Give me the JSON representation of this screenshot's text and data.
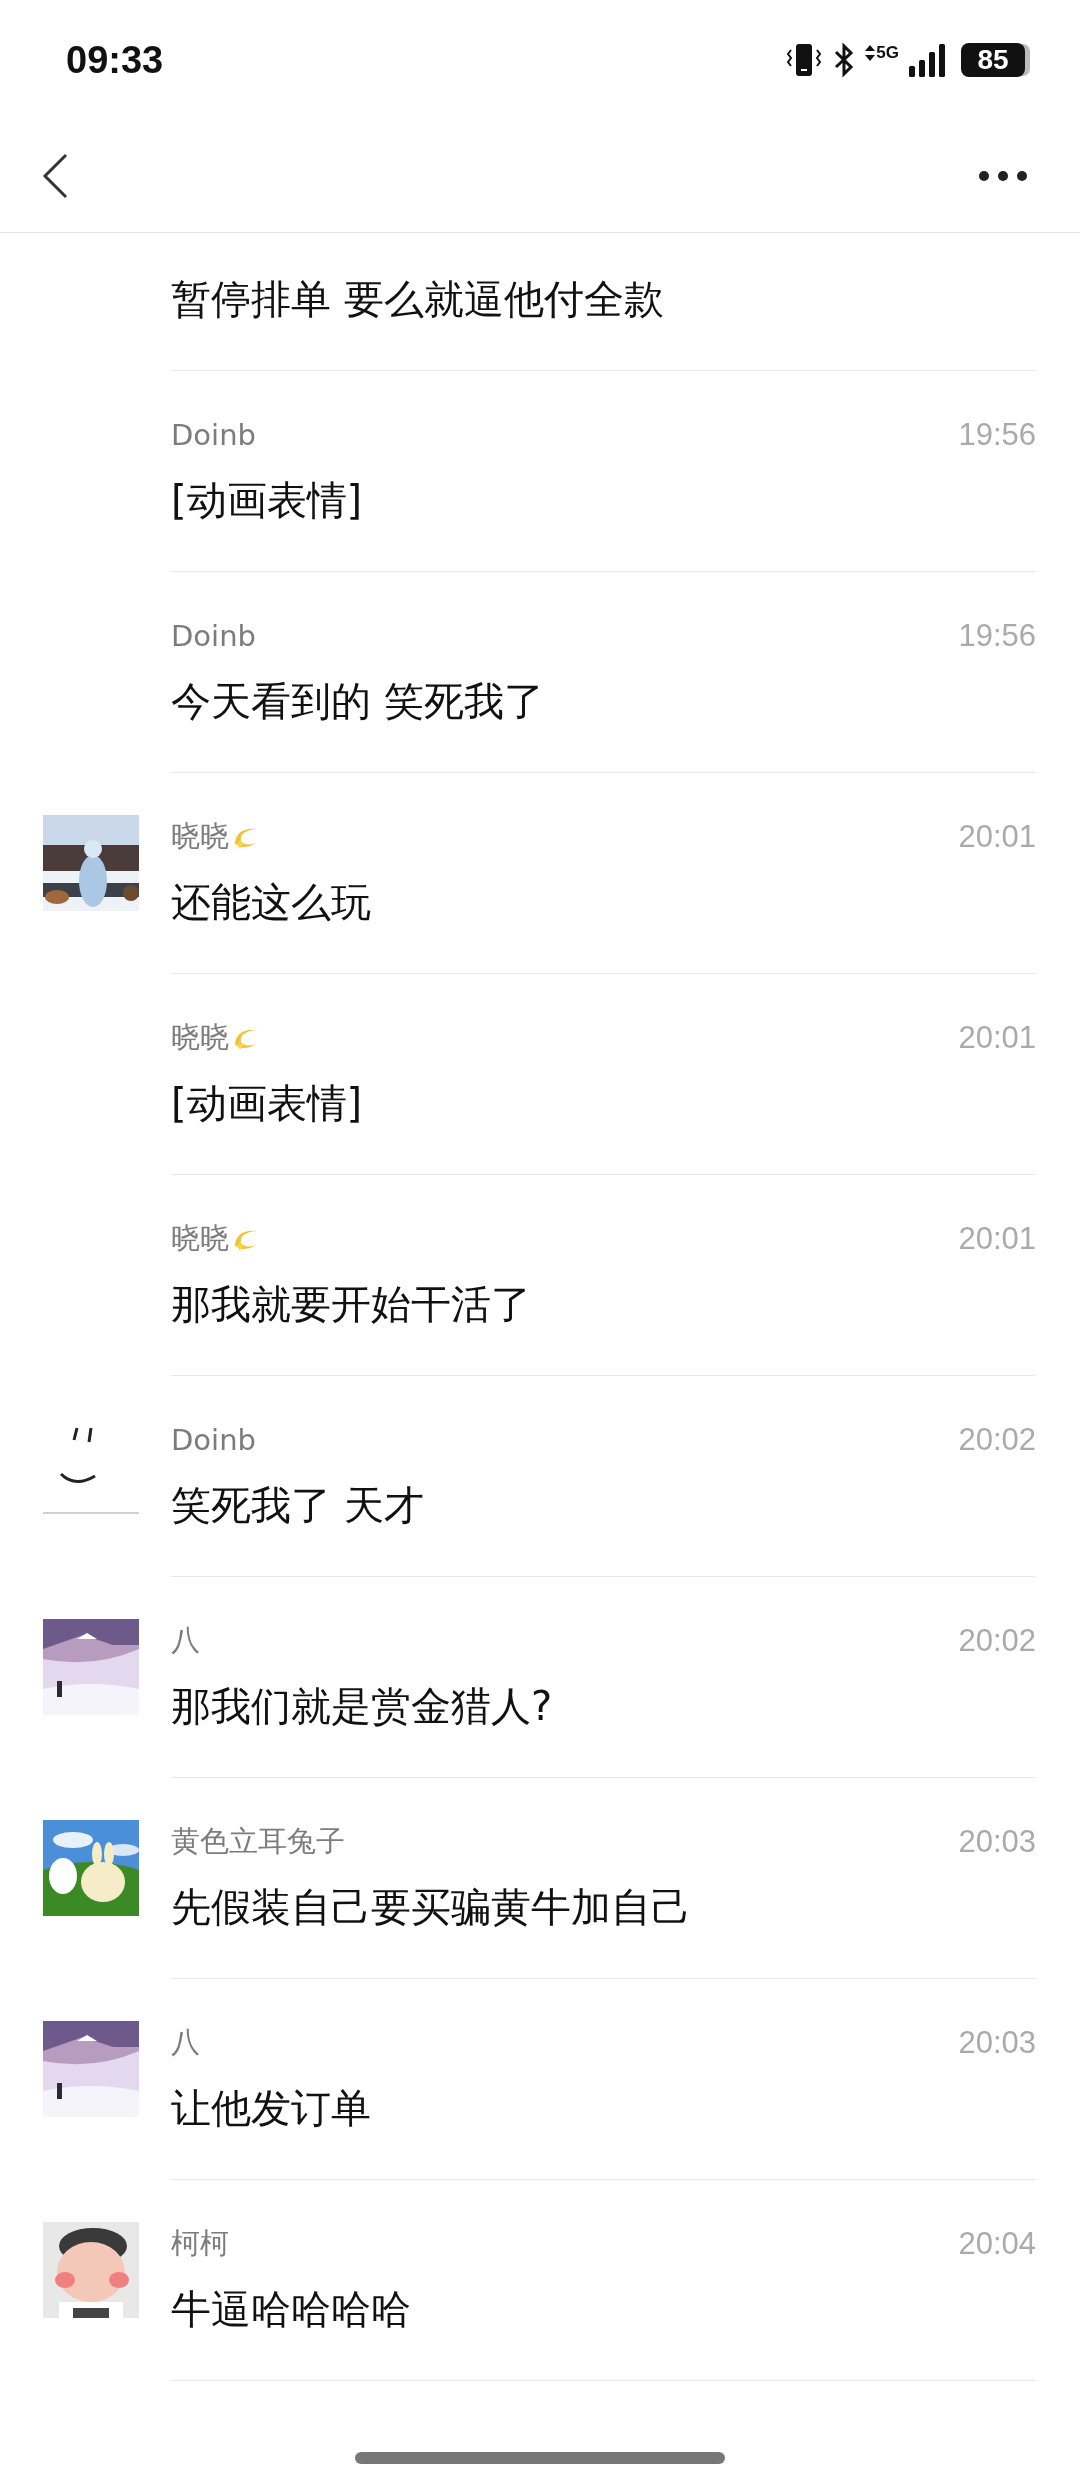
{
  "status_bar": {
    "time": "09:33",
    "network": "5G",
    "battery": "85"
  },
  "messages": [
    {
      "text": "暂停排单 要么就逼他付全款",
      "avatar": false
    },
    {
      "name": "Doinb",
      "badge": false,
      "time": "19:56",
      "text": "[动画表情]",
      "avatar": false
    },
    {
      "name": "Doinb",
      "badge": false,
      "time": "19:56",
      "text": "今天看到的 笑死我了",
      "avatar": false
    },
    {
      "name": "晓晓",
      "badge": true,
      "time": "20:01",
      "text": "还能这么玩",
      "avatar": true
    },
    {
      "name": "晓晓",
      "badge": true,
      "time": "20:01",
      "text": "[动画表情]",
      "avatar": false
    },
    {
      "name": "晓晓",
      "badge": true,
      "time": "20:01",
      "text": "那我就要开始干活了",
      "avatar": false
    },
    {
      "name": "Doinb",
      "badge": false,
      "time": "20:02",
      "text": "笑死我了 天才",
      "avatar": true
    },
    {
      "name": "八",
      "badge": false,
      "time": "20:02",
      "text": "那我们就是赏金猎人?",
      "avatar": true
    },
    {
      "name": "黄色立耳兔子",
      "badge": false,
      "time": "20:03",
      "text": "先假装自己要买骗黄牛加自己",
      "avatar": true
    },
    {
      "name": "八",
      "badge": false,
      "time": "20:03",
      "text": "让他发订单",
      "avatar": true
    },
    {
      "name": "柯柯",
      "badge": false,
      "time": "20:04",
      "text": "牛逼哈哈哈哈",
      "avatar": true
    }
  ]
}
